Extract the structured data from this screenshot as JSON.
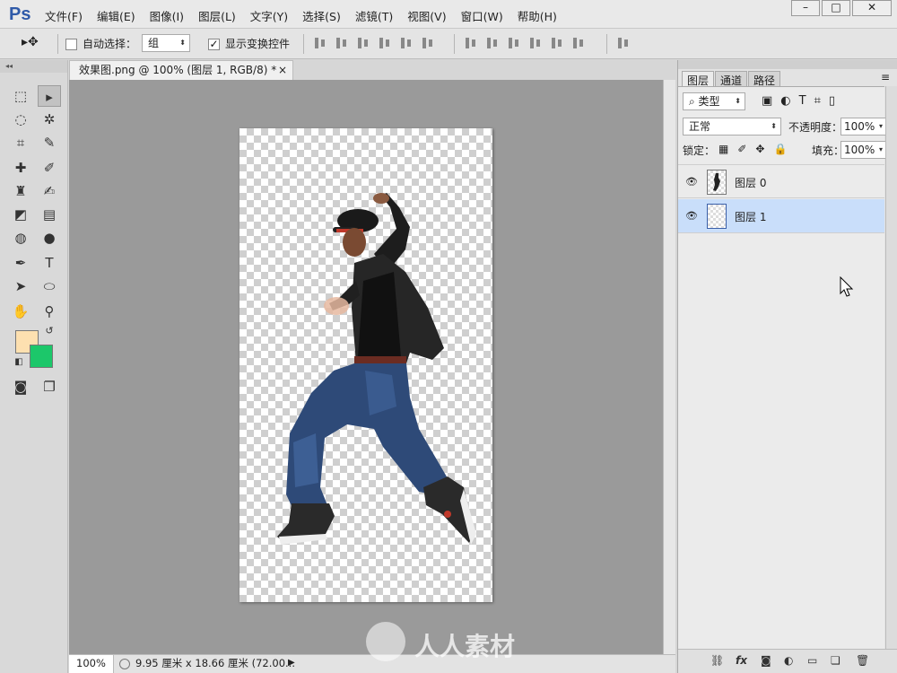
{
  "app": {
    "logo": "Ps",
    "menu": [
      "文件(F)",
      "编辑(E)",
      "图像(I)",
      "图层(L)",
      "文字(Y)",
      "选择(S)",
      "滤镜(T)",
      "视图(V)",
      "窗口(W)",
      "帮助(H)"
    ],
    "window_controls": [
      "–",
      "□",
      "✕"
    ]
  },
  "options": {
    "auto_select_label": "自动选择：",
    "auto_select_checked": false,
    "auto_select_mode": "组",
    "show_transform_label": "显示变换控件",
    "show_transform_checked": true
  },
  "document": {
    "tab_title": "效果图.png @ 100% (图层 1, RGB/8) *",
    "close": "×"
  },
  "status": {
    "zoom": "100%",
    "doc_info": "9.95 厘米 x 18.66 厘米 (72.00..."
  },
  "colors": {
    "foreground": "#fde0b0",
    "background": "#1cc76a"
  },
  "layers_panel": {
    "tabs": [
      "图层",
      "通道",
      "路径"
    ],
    "active_tab": "图层",
    "filter_kind": "类型",
    "blend_mode": "正常",
    "opacity_label": "不透明度：",
    "opacity_value": "100%",
    "lock_label": "锁定：",
    "fill_label": "填充：",
    "fill_value": "100%",
    "layers": [
      {
        "name": "图层 0",
        "visible": true,
        "selected": false
      },
      {
        "name": "图层 1",
        "visible": true,
        "selected": true
      }
    ],
    "bottom_icons": [
      "link-icon",
      "fx-icon",
      "mask-icon",
      "adjustment-icon",
      "folder-icon",
      "new-layer-icon",
      "trash-icon"
    ]
  },
  "watermark": {
    "text": "人人素材"
  }
}
